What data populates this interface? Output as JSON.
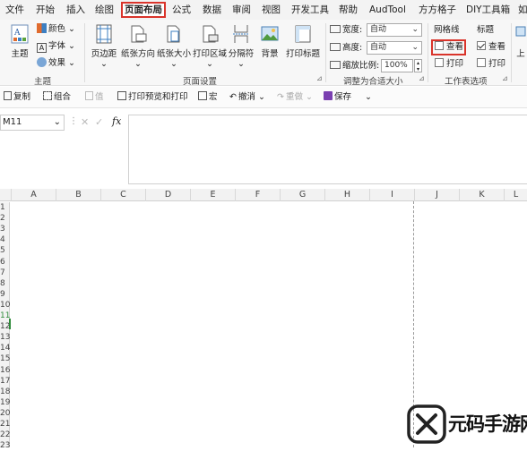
{
  "menubar": {
    "items": [
      "文件",
      "开始",
      "插入",
      "绘图",
      "页面布局",
      "公式",
      "数据",
      "审阅",
      "视图",
      "开发工具",
      "帮助",
      "AudTool",
      "方方格子",
      "DIY工具箱",
      "如"
    ],
    "active_index": 4
  },
  "ribbon": {
    "theme_group": {
      "theme_label": "主题",
      "colors_label": "颜色",
      "fonts_label": "字体",
      "effects_label": "效果",
      "group_label": "主题"
    },
    "page_setup": {
      "buttons": [
        "页边距",
        "纸张方向",
        "纸张大小",
        "打印区域",
        "分隔符",
        "背景",
        "打印标题"
      ],
      "group_label": "页面设置"
    },
    "scale_fit": {
      "width_label": "宽度:",
      "width_value": "自动",
      "height_label": "高度:",
      "height_value": "自动",
      "scale_label": "缩放比例:",
      "scale_value": "100%",
      "group_label": "调整为合适大小"
    },
    "sheet_options": {
      "gridlines_title": "网格线",
      "headings_title": "标题",
      "view_label": "查看",
      "print_label": "打印",
      "gridlines_view": false,
      "gridlines_print": false,
      "headings_view": true,
      "headings_print": false,
      "group_label": "工作表选项"
    },
    "arrange": {
      "up_label": "上"
    }
  },
  "qat": {
    "items": [
      "复制",
      "组合",
      "值",
      "打印预览和打印",
      "宏",
      "撤消",
      "重做",
      "保存"
    ]
  },
  "formula": {
    "namebox": "M11",
    "fx": "fx"
  },
  "grid": {
    "columns": [
      "A",
      "B",
      "C",
      "D",
      "E",
      "F",
      "G",
      "H",
      "I",
      "J",
      "K",
      "L"
    ],
    "rows": [
      "1",
      "2",
      "3",
      "4",
      "5",
      "6",
      "7",
      "8",
      "9",
      "10",
      "11",
      "12",
      "13",
      "14",
      "15",
      "16",
      "17",
      "18",
      "19",
      "20",
      "21",
      "22",
      "23"
    ],
    "active_row": "11"
  },
  "watermark": {
    "text": "元码手游网"
  },
  "colors": {
    "accent_red": "#d9342b",
    "save_purple": "#7a3fb0",
    "green": "#2e8b3a"
  }
}
